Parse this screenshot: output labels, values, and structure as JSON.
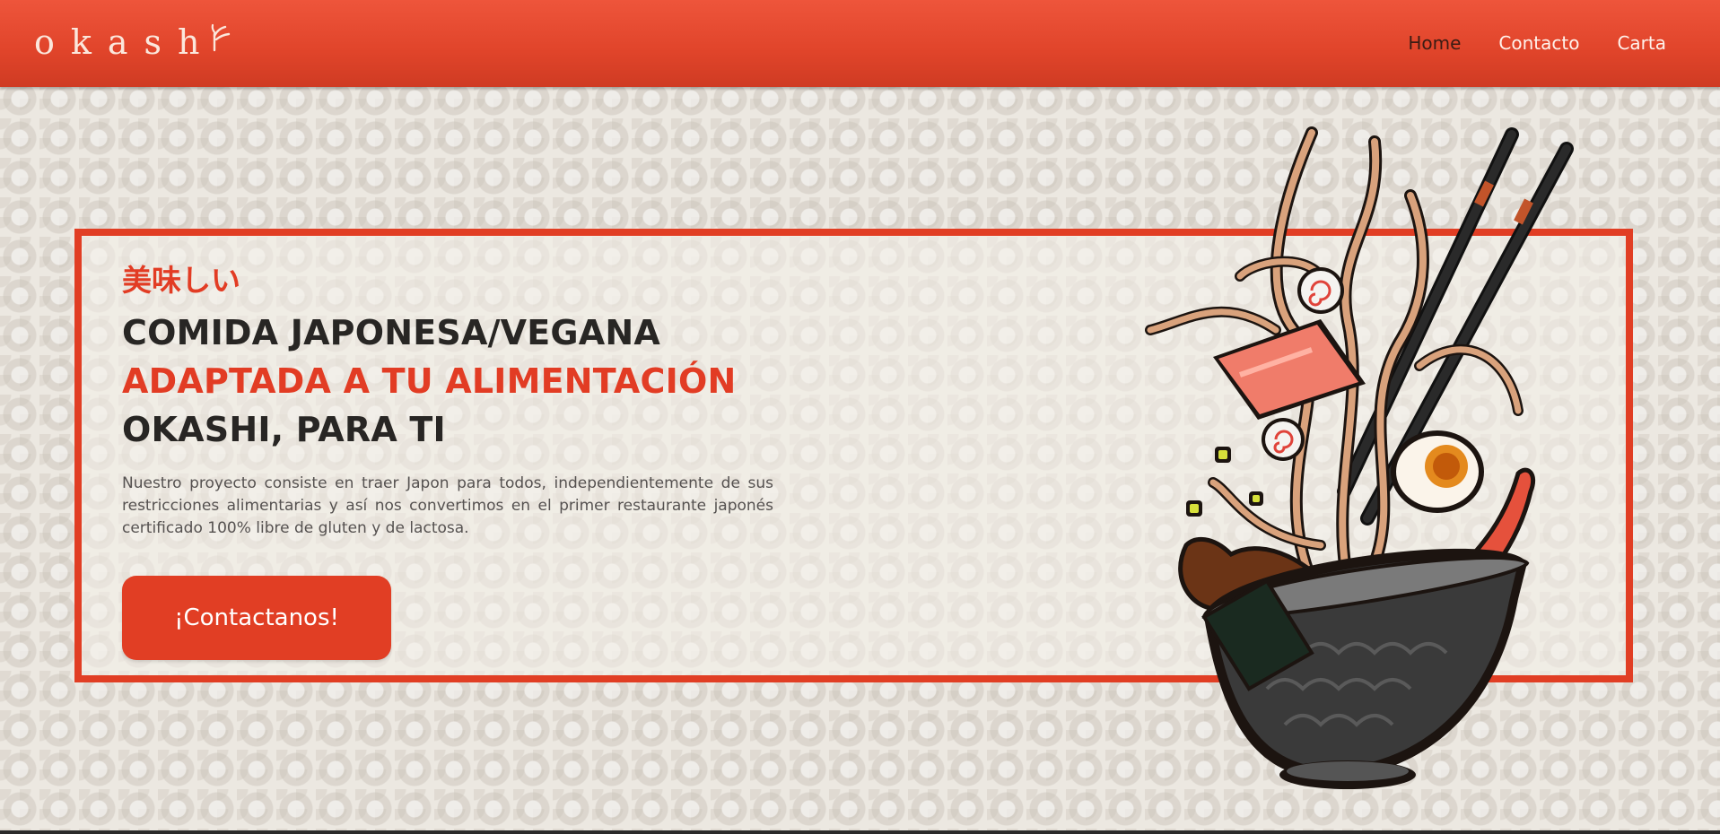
{
  "header": {
    "logo_text": "okash",
    "logo_icon": "sprout-icon",
    "nav": [
      {
        "label": "Home",
        "active": true
      },
      {
        "label": "Contacto",
        "active": false
      },
      {
        "label": "Carta",
        "active": false
      }
    ]
  },
  "hero": {
    "kanji": "美味しい",
    "line1": "COMIDA JAPONESA/VEGANA",
    "line2": "ADAPTADA A TU ALIMENTACIÓN",
    "line3": "OKASHI, PARA TI",
    "description": "Nuestro proyecto consiste en traer Japon para todos, independientemente de sus restricciones alimentarias y así nos convertimos en el primer restaurante japonés certificado 100% libre de gluten y de lactosa.",
    "cta_label": "¡Contactanos!",
    "illustration": "ramen-bowl-illustration"
  },
  "colors": {
    "accent": "#e13e24",
    "header_top": "#ee553b",
    "header_bottom": "#cf3b23",
    "text_dark": "#282624",
    "background": "#ece8e1"
  }
}
